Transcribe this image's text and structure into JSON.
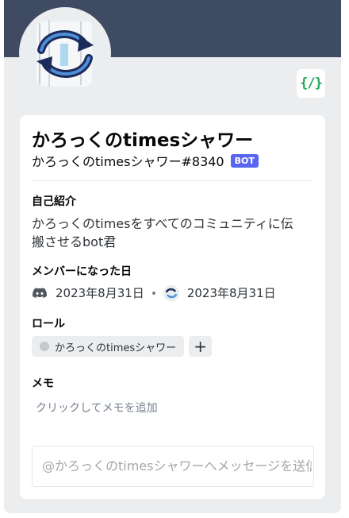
{
  "profile": {
    "display_name": "かろっくのtimesシャワー",
    "tag": "かろっくのtimesシャワー#8340",
    "bot_tag": "BOT",
    "badge_glyph": "{/}",
    "accent_color": "#3f4a63"
  },
  "about": {
    "title": "自己紹介",
    "text": "かろっくのtimesをすべてのコミュニティに伝搬させるbot君"
  },
  "member_since": {
    "title": "メンバーになった日",
    "discord_date": "2023年8月31日",
    "separator": "•",
    "server_date": "2023年8月31日"
  },
  "roles": {
    "title": "ロール",
    "items": [
      {
        "label": "かろっくのtimesシャワー",
        "color": "#c4c9ce"
      }
    ],
    "add_label": "+"
  },
  "note": {
    "title": "メモ",
    "placeholder": "クリックしてメモを追加"
  },
  "message": {
    "placeholder": "@かろっくのtimesシャワーへメッセージを送信"
  }
}
